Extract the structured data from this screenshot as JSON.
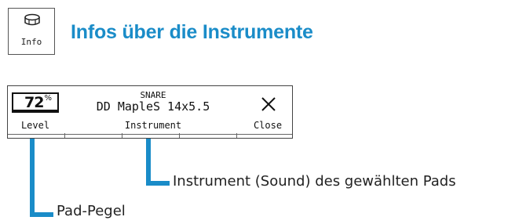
{
  "info_button": {
    "label": "Info",
    "icon": "drum-icon"
  },
  "heading": "Infos über die Instrumente",
  "lcd": {
    "level_value": "72",
    "level_unit": "%",
    "level_label": "Level",
    "sound_category": "SNARE",
    "sound_name": "DD MapleS 14x5.5",
    "instrument_label": "Instrument",
    "close_label": "Close"
  },
  "annotations": {
    "instrument": "Instrument (Sound) des gewählten Pads",
    "pad_level": "Pad-Pegel"
  },
  "colors": {
    "accent": "#1a8cc8"
  }
}
